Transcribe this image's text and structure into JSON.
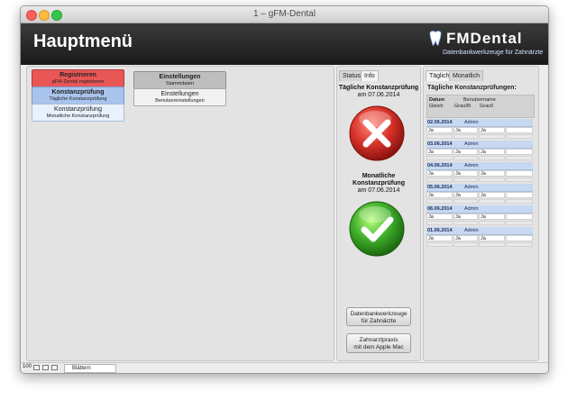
{
  "window": {
    "title": "1 – gFM-Dental"
  },
  "header": {
    "title": "Hauptmenü",
    "logo_name": "FMDental",
    "logo_tagline": "Datenbankwerkzeuge für Zahnärzte"
  },
  "menu": {
    "register": {
      "title": "Registrieren",
      "sub": "gFM-Dental registrieren"
    },
    "daily_check": {
      "title": "Konstanzprüfung",
      "sub": "Tägliche Konstanzprüfung"
    },
    "monthly_check": {
      "title": "Konstanzprüfung",
      "sub": "Monatliche Konstanzprüfung"
    },
    "settings_master": {
      "title": "Einstellungen",
      "sub": "Stammdaten"
    },
    "settings_user": {
      "title": "Einstellungen",
      "sub": "Benutzereinstellungen"
    }
  },
  "status_panel": {
    "tabs": [
      "Status",
      "Info"
    ],
    "daily_title": "Tägliche Konstanzprüfung",
    "daily_date": "am 07.06.2014",
    "daily_state": "failed",
    "monthly_title_1": "Monatliche",
    "monthly_title_2": "Konstanzprüfung",
    "monthly_date": "am 07.06.2014",
    "monthly_state": "passed",
    "btn_tools_1": "Datenbankwerkzeuge",
    "btn_tools_2": "für Zahnärzte",
    "btn_practice_1": "Zahnarztpraxis",
    "btn_practice_2": "mit dem Apple Mac"
  },
  "right_panel": {
    "tabs": [
      "Täglich",
      "Monatlich"
    ],
    "heading": "Tägliche Konstanzprüfungen:",
    "columns": {
      "datum": "Datum",
      "benutzername": "Benutzername",
      "gleich": "Gleich",
      "grau95": "Grau95",
      "grau5": "Grau5"
    },
    "entries": [
      {
        "date": "02.06.2014",
        "user": "Admin",
        "vals": [
          "Ja",
          "Ja",
          "Ja"
        ]
      },
      {
        "date": "03.06.2014",
        "user": "Admin",
        "vals": [
          "Ja",
          "Ja",
          "Ja"
        ]
      },
      {
        "date": "04.06.2014",
        "user": "Admin",
        "vals": [
          "Ja",
          "Ja",
          "Ja"
        ]
      },
      {
        "date": "05.06.2014",
        "user": "Admin",
        "vals": [
          "Ja",
          "Ja",
          "Ja"
        ]
      },
      {
        "date": "06.06.2014",
        "user": "Admin",
        "vals": [
          "Ja",
          "Ja",
          "Ja"
        ]
      },
      {
        "date": "01.06.2014",
        "user": "Admin",
        "vals": [
          "Ja",
          "Ja",
          "Ja"
        ]
      }
    ]
  },
  "statusbar": {
    "zoom": "100",
    "mode": "Blättern"
  },
  "colors": {
    "header_bg": "#2a2a2a",
    "red_button": "#e95656",
    "blue_button": "#a8c4ec",
    "fail_red": "#d9332a",
    "pass_green": "#3fae2a"
  },
  "icons": [
    "close-light-icon",
    "minimize-light-icon",
    "zoom-light-icon",
    "tooth-logo-icon",
    "fail-x-icon",
    "pass-check-icon",
    "zoom-minus-icon",
    "zoom-plus-icon",
    "layout-icon"
  ]
}
